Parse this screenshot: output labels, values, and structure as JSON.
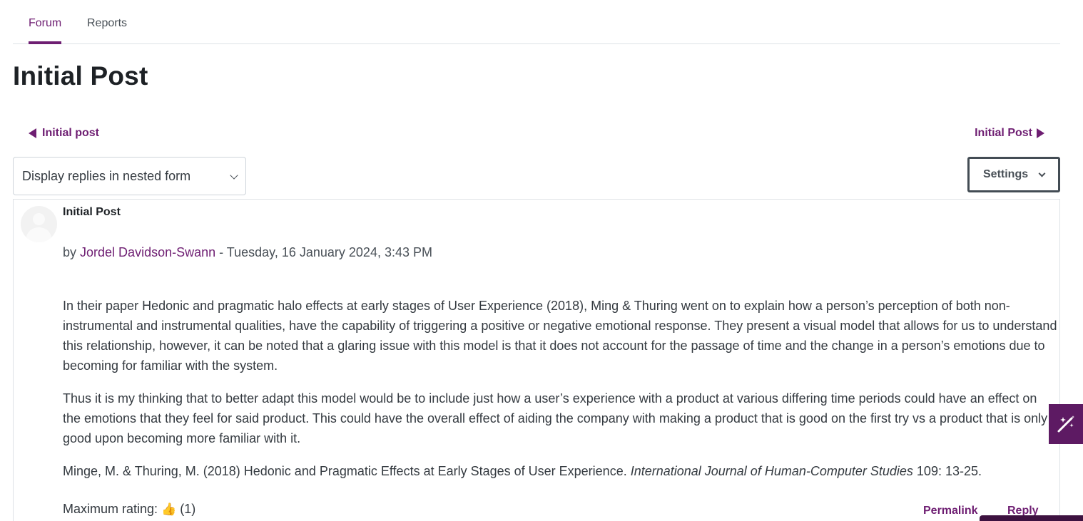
{
  "tabs": [
    {
      "label": "Forum",
      "active": true
    },
    {
      "label": "Reports",
      "active": false
    }
  ],
  "page": {
    "title": "Initial Post"
  },
  "navigation": {
    "prev_label": "Initial post",
    "next_label": "Initial Post"
  },
  "display_mode": {
    "selected": "Display replies in nested form"
  },
  "settings": {
    "label": "Settings"
  },
  "post": {
    "subject": "Initial Post",
    "by_prefix": "by",
    "author": "Jordel Davidson-Swann",
    "date": " - Tuesday, 16 January 2024, 3:43 PM",
    "paragraphs": [
      "In their paper Hedonic and pragmatic halo effects at early stages of User Experience (2018), Ming & Thuring went on to explain how a person’s perception of both non-instrumental and instrumental qualities, have the capability of triggering a positive or negative emotional response. They present a visual model that allows for us to understand this relationship, however, it can be noted that a glaring issue with this model is that it does not account for the passage of time and the change in a person’s emotions due to becoming for familiar with the system.",
      "Thus it is my thinking that to better adapt this model would be to include just how a user’s experience with a product at various differing time periods could have an effect on the emotions that they feel for said product. This could have the overall effect of aiding the company with making a product that is good on the first try vs a product that is only good upon becoming more familiar with it."
    ],
    "reference": {
      "authors_title": "Minge, M. & Thuring, M. (2018) Hedonic and Pragmatic Effects at Early Stages of User Experience. ",
      "journal": "International Journal of Human-Computer Studies",
      "pages": " 109: 13-25."
    },
    "rating_label": "Maximum rating: ",
    "rating_icon": "👍",
    "rating_count": " (1)",
    "actions": {
      "permalink": "Permalink",
      "reply": "Reply"
    }
  },
  "colors": {
    "brand": "#6e1e72",
    "brand_dark": "#5d1a63"
  }
}
